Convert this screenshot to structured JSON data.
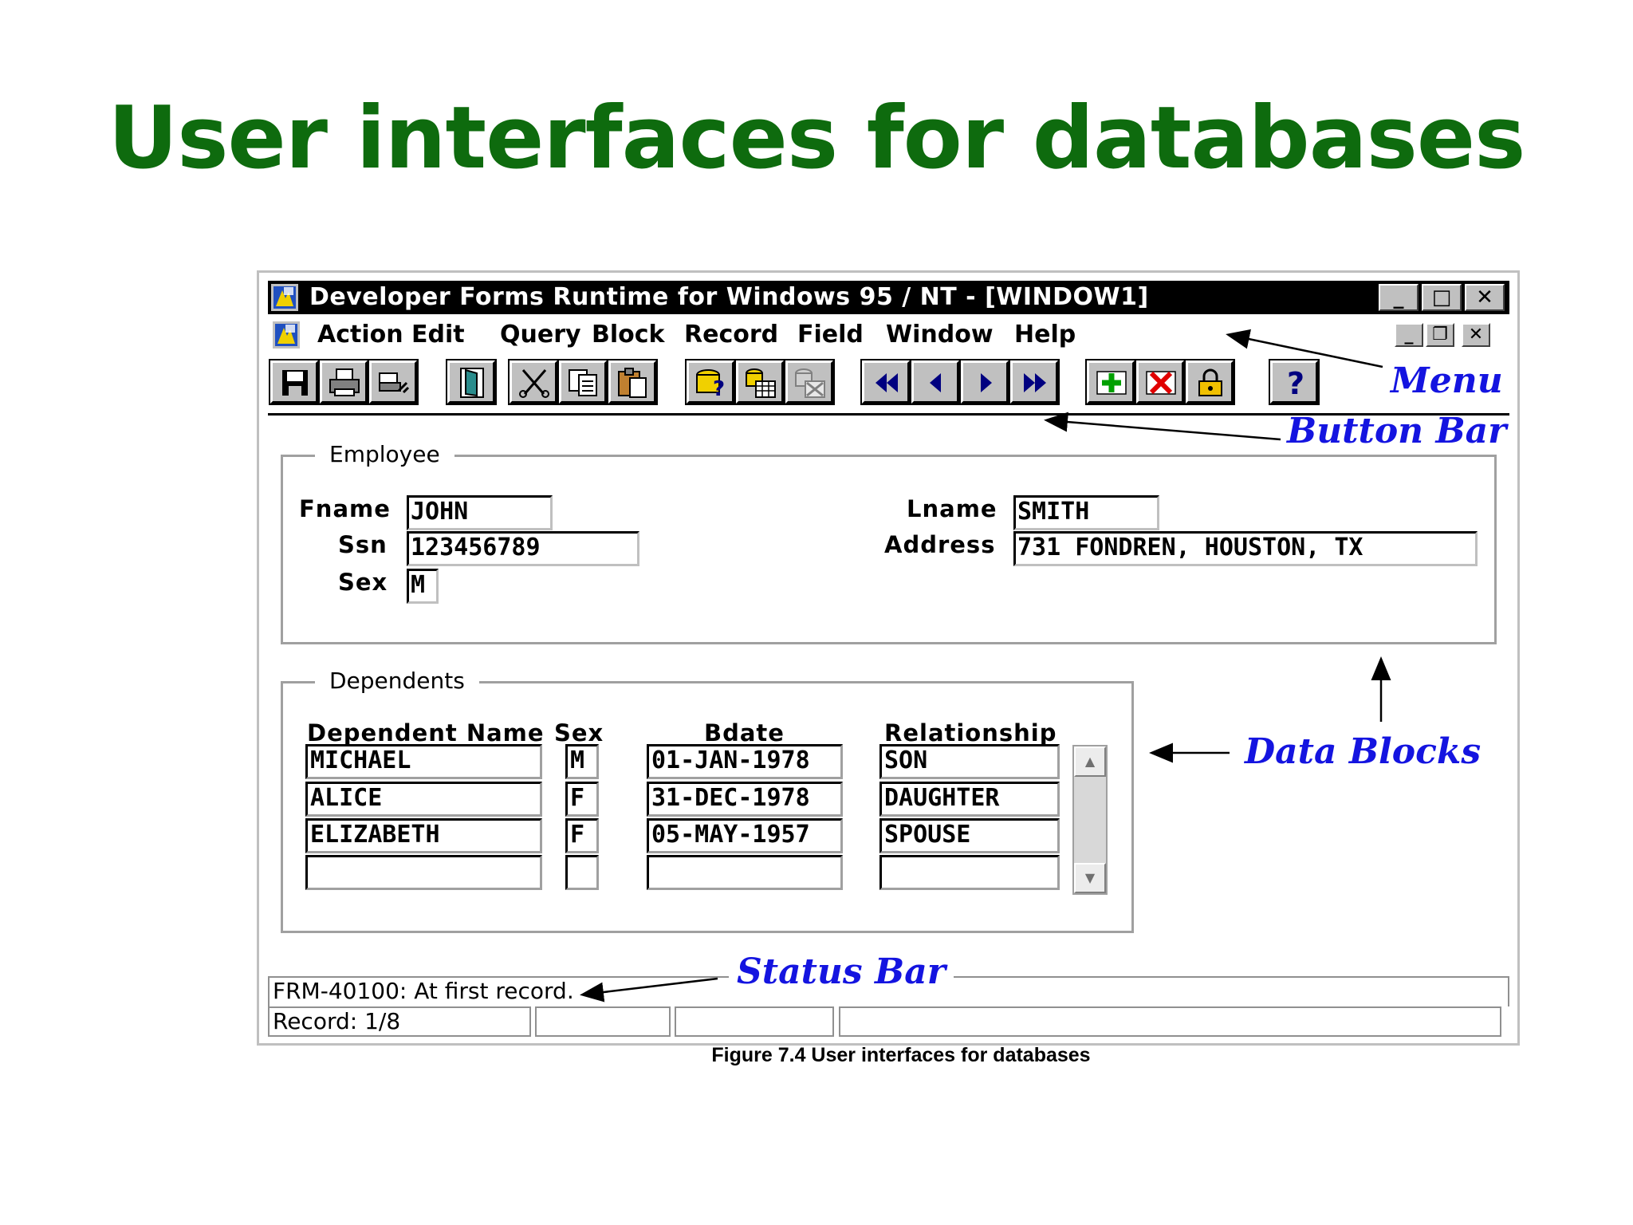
{
  "slide": {
    "title": "User interfaces for databases",
    "caption": "Figure 7.4 User interfaces for databases"
  },
  "window": {
    "title": "Developer Forms Runtime for Windows 95 / NT - [WINDOW1]",
    "controls": {
      "minimize": "_",
      "maximize": "□",
      "close": "✕"
    }
  },
  "menu": {
    "items": [
      "Action",
      "Edit",
      "Query",
      "Block",
      "Record",
      "Field",
      "Window",
      "Help"
    ],
    "mdi_controls": {
      "minimize": "_",
      "restore": "❐",
      "close": "✕"
    }
  },
  "toolbar": {
    "buttons": [
      "save-icon",
      "print-icon",
      "print-setup-icon",
      "exit-icon",
      "cut-icon",
      "copy-icon",
      "paste-icon",
      "enter-query-icon",
      "execute-query-icon",
      "cancel-query-icon",
      "first-record-icon",
      "previous-record-icon",
      "next-record-icon",
      "last-record-icon",
      "insert-record-icon",
      "delete-record-icon",
      "lock-record-icon",
      "help-icon"
    ],
    "help_label": "?"
  },
  "employee": {
    "group_label": "Employee",
    "fname_label": "Fname",
    "fname": "JOHN",
    "ssn_label": "Ssn",
    "ssn": "123456789",
    "sex_label": "Sex",
    "sex": "M",
    "lname_label": "Lname",
    "lname": "SMITH",
    "address_label": "Address",
    "address": "731 FONDREN, HOUSTON, TX"
  },
  "dependents": {
    "group_label": "Dependents",
    "columns": [
      "Dependent Name",
      "Sex",
      "Bdate",
      "Relationship"
    ],
    "rows": [
      [
        "MICHAEL",
        "M",
        "01-JAN-1978",
        "SON"
      ],
      [
        "ALICE",
        "F",
        "31-DEC-1978",
        "DAUGHTER"
      ],
      [
        "ELIZABETH",
        "F",
        "05-MAY-1957",
        "SPOUSE"
      ],
      [
        "",
        "",
        "",
        ""
      ]
    ]
  },
  "status": {
    "message": "FRM-40100: At first record.",
    "record": "Record: 1/8"
  },
  "annotations": {
    "menu": "Menu",
    "button_bar": "Button Bar",
    "data_blocks": "Data Blocks",
    "status_bar": "Status Bar"
  },
  "colors": {
    "title_green": "#0e6b0e",
    "annotation_blue": "#1414e0",
    "window_face": "#c0c0c0"
  }
}
